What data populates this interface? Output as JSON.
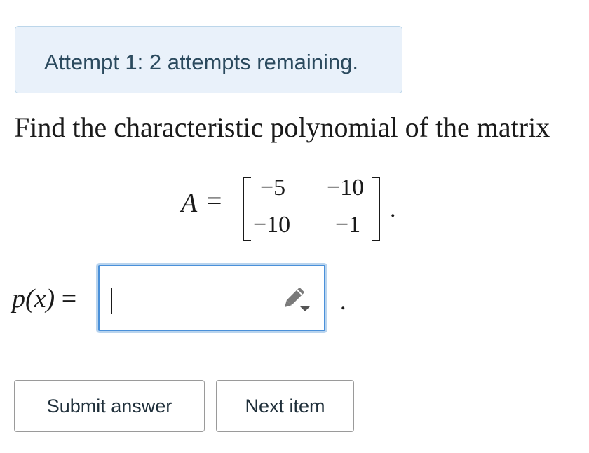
{
  "attempt_banner": {
    "text": "Attempt 1: 2 attempts remaining."
  },
  "problem": {
    "prompt": "Find the characteristic polynomial of the matrix",
    "matrix_symbol": "A",
    "equals": "=",
    "matrix": [
      [
        "−5",
        "−10"
      ],
      [
        "−10",
        "−1"
      ]
    ],
    "trailing_period": "."
  },
  "answer": {
    "label": "p(x)",
    "equals": "=",
    "value": "",
    "trailing_period": ".",
    "icon": "pencil-dropdown-icon"
  },
  "buttons": {
    "submit": "Submit answer",
    "next": "Next item"
  },
  "colors": {
    "banner_bg": "#e9f1fa",
    "banner_border": "#bcd6ea",
    "input_focus": "#4a90d9"
  }
}
